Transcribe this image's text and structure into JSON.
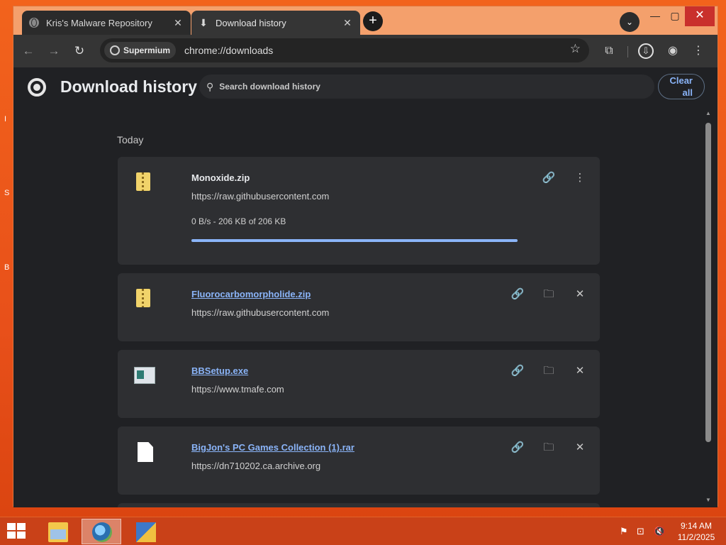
{
  "desktop": {
    "edge_labels": [
      "I",
      "S",
      "B"
    ]
  },
  "browser": {
    "tabs": [
      {
        "title": "Kris's Malware Repository",
        "icon": "globe-icon",
        "close": "✕"
      },
      {
        "title": "Download history",
        "icon": "download-icon",
        "close": "✕"
      }
    ],
    "new_tab": "+",
    "tab_search": "⌄",
    "window_controls": {
      "minimize": "—",
      "maximize": "▢",
      "close": "✕"
    },
    "nav": {
      "back": "←",
      "forward": "→",
      "reload": "↻"
    },
    "omnibox": {
      "chip_label": "Supermium",
      "url": "chrome://downloads"
    },
    "toolbar_icons": {
      "star": "☆",
      "extensions": "⧉",
      "downloads": "⇩",
      "profile": "◉",
      "menu": "⋮"
    }
  },
  "downloads_page": {
    "title": "Download history",
    "search_placeholder": "Search download history",
    "clear_all": [
      "Clear",
      "all"
    ],
    "date_group": "Today",
    "items": [
      {
        "filename": "Monoxide.zip",
        "source": "https://raw.githubusercontent.com",
        "status": "0 B/s - 206 KB of 206 KB",
        "progress": 1.0,
        "icon": "zip-file-icon",
        "in_progress": true
      },
      {
        "filename": "Fluorocarbomorpholide.zip",
        "source": "https://raw.githubusercontent.com",
        "icon": "zip-file-icon",
        "in_progress": false
      },
      {
        "filename": "BBSetup.exe",
        "source": "https://www.tmafe.com",
        "icon": "exe-file-icon",
        "in_progress": false
      },
      {
        "filename": "BigJon's PC Games Collection (1).rar",
        "source": "https://dn710202.ca.archive.org",
        "icon": "document-file-icon",
        "in_progress": false
      }
    ],
    "actions": {
      "copy_link": "🔗",
      "show_in_folder": "🗀",
      "remove": "✕",
      "more": "⋮"
    }
  },
  "taskbar": {
    "time": "9:14 AM",
    "date": "11/2/2025",
    "tray": {
      "flag": "⚑",
      "network": "⊡",
      "volume": "🔇"
    }
  },
  "colors": {
    "desktop": "#e8501a",
    "page_bg": "#202124",
    "card_bg": "#2e2f32",
    "link": "#8ab4f8",
    "taskbar": "#c94118"
  }
}
